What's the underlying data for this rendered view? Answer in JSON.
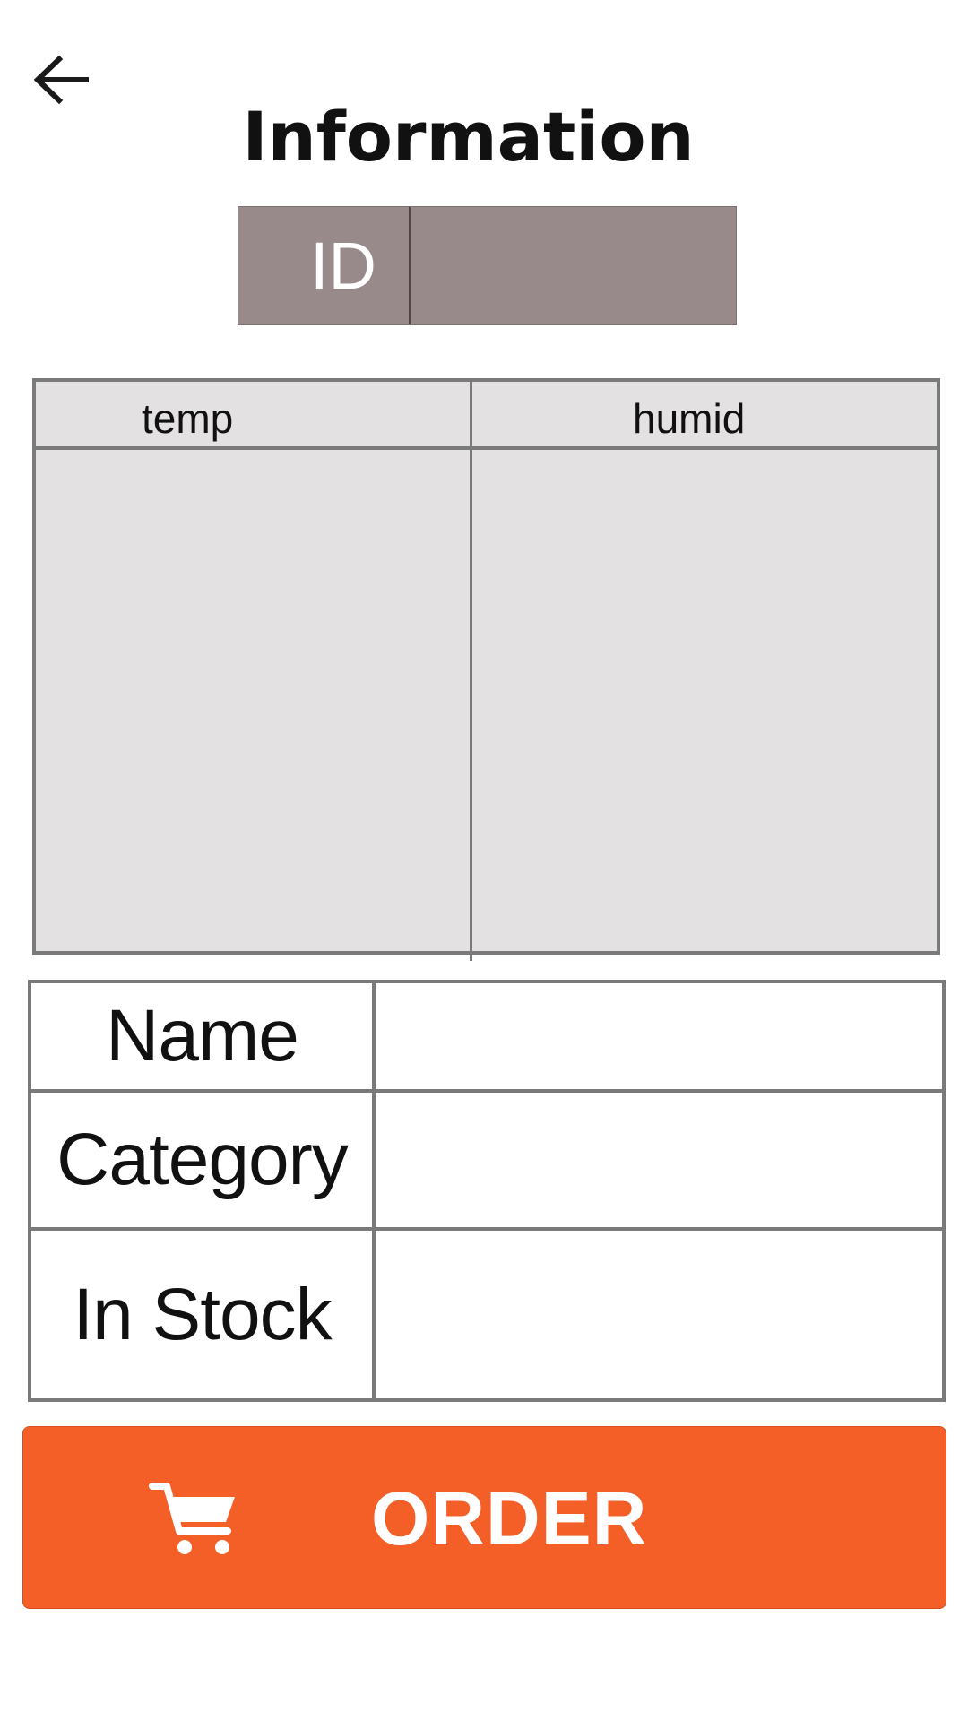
{
  "header": {
    "back_icon": "arrow-left-icon",
    "title": "Information"
  },
  "id_field": {
    "label": "ID",
    "value": ""
  },
  "sensor_table": {
    "columns": [
      "temp",
      "humid"
    ],
    "rows": [
      {
        "temp": "",
        "humid": ""
      }
    ]
  },
  "info_table": {
    "rows": [
      {
        "label": "Name",
        "value": ""
      },
      {
        "label": "Category",
        "value": ""
      },
      {
        "label": "In Stock",
        "value": ""
      }
    ]
  },
  "order_button": {
    "icon": "cart-icon",
    "label": "ORDER",
    "color": "#f45f28"
  },
  "colors": {
    "id_box": "#988a8a",
    "table_background": "#e3e1e2",
    "border": "#7a7a7a"
  }
}
